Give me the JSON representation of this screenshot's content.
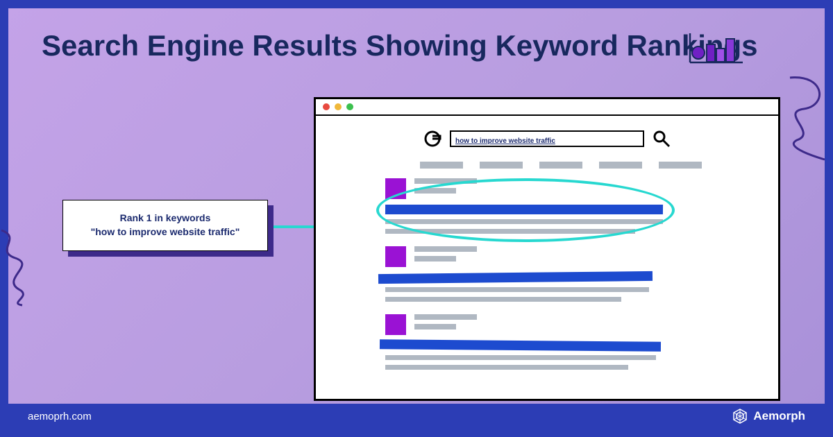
{
  "title": "Search Engine Results Showing Keyword Rankings",
  "callout": {
    "line1": "Rank 1 in keywords",
    "line2": "\"how to improve website traffic\""
  },
  "search": {
    "query": "how to improve website traffic"
  },
  "footer": {
    "url": "aemoprh.com",
    "brand": "Aemorph"
  },
  "colors": {
    "accent_blue": "#2c3db5",
    "link_blue": "#1d4bcf",
    "icon_purple": "#9a12d4",
    "highlight_teal": "#27d8d0"
  }
}
